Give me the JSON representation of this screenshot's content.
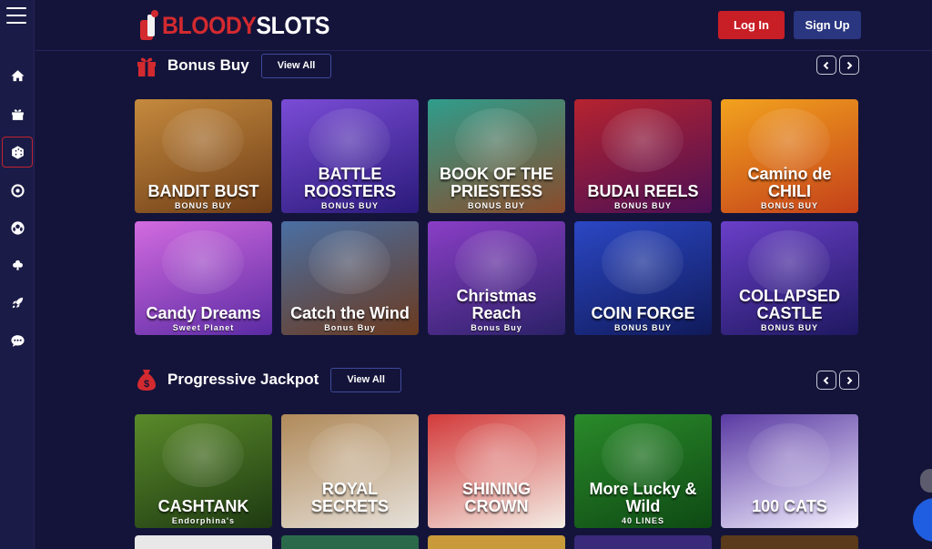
{
  "header": {
    "logo_part1": "BLOODY",
    "logo_part2": "SLOTS",
    "login_label": "Log In",
    "signup_label": "Sign Up"
  },
  "sidebar": {
    "items": [
      {
        "name": "home",
        "icon": "home-icon"
      },
      {
        "name": "promotions",
        "icon": "gift-icon"
      },
      {
        "name": "slots",
        "icon": "dice-icon",
        "active": true
      },
      {
        "name": "live-casino",
        "icon": "roulette-icon"
      },
      {
        "name": "sports",
        "icon": "soccer-ball-icon"
      },
      {
        "name": "table-games",
        "icon": "cards-icon"
      },
      {
        "name": "crash-games",
        "icon": "rocket-icon"
      },
      {
        "name": "support",
        "icon": "chat-icon"
      }
    ]
  },
  "sections": [
    {
      "title": "Bonus Buy",
      "icon": "gift-icon",
      "view_all": "View All",
      "games": [
        {
          "title": "BANDIT BUST",
          "sub": "BONUS BUY",
          "colors": [
            "#c58a3e",
            "#6e3d17"
          ]
        },
        {
          "title": "BATTLE ROOSTERS",
          "sub": "BONUS BUY",
          "colors": [
            "#7a4cd6",
            "#2a1a7a"
          ]
        },
        {
          "title": "BOOK OF THE PRIESTESS",
          "sub": "BONUS BUY",
          "colors": [
            "#2f9d8c",
            "#8a4a2a"
          ]
        },
        {
          "title": "BUDAI REELS",
          "sub": "BONUS BUY",
          "colors": [
            "#b6232f",
            "#4b1056"
          ]
        },
        {
          "title": "Camino de CHILI",
          "sub": "BONUS BUY",
          "colors": [
            "#f2a21e",
            "#c4401a"
          ]
        },
        {
          "title": "Candy Dreams",
          "sub": "Sweet Planet",
          "colors": [
            "#d36be0",
            "#5a2aa3"
          ]
        },
        {
          "title": "Catch the Wind",
          "sub": "Bonus Buy",
          "colors": [
            "#4a6fa3",
            "#6b3a1e"
          ]
        },
        {
          "title": "Christmas Reach",
          "sub": "Bonus Buy",
          "colors": [
            "#8a3ec6",
            "#2b2167"
          ]
        },
        {
          "title": "COIN FORGE",
          "sub": "BONUS BUY",
          "colors": [
            "#2b47c4",
            "#101a5a"
          ]
        },
        {
          "title": "COLLAPSED CASTLE",
          "sub": "BONUS BUY",
          "colors": [
            "#6a3fc8",
            "#1e1860"
          ]
        }
      ]
    },
    {
      "title": "Progressive Jackpot",
      "icon": "money-bag-icon",
      "view_all": "View All",
      "games": [
        {
          "title": "CASHTANK",
          "sub": "Endorphina's",
          "colors": [
            "#5a8a2a",
            "#1e3a12"
          ]
        },
        {
          "title": "ROYAL SECRETS",
          "sub": "",
          "colors": [
            "#b08a5a",
            "#e6e1da"
          ]
        },
        {
          "title": "SHINING CROWN",
          "sub": "",
          "colors": [
            "#d23a3a",
            "#f4eee6"
          ]
        },
        {
          "title": "More Lucky & Wild",
          "sub": "40 LINES",
          "colors": [
            "#2a8a2a",
            "#0e4a14"
          ]
        },
        {
          "title": "100 CATS",
          "sub": "",
          "colors": [
            "#5a3aa3",
            "#f4f0ff"
          ]
        }
      ]
    }
  ]
}
